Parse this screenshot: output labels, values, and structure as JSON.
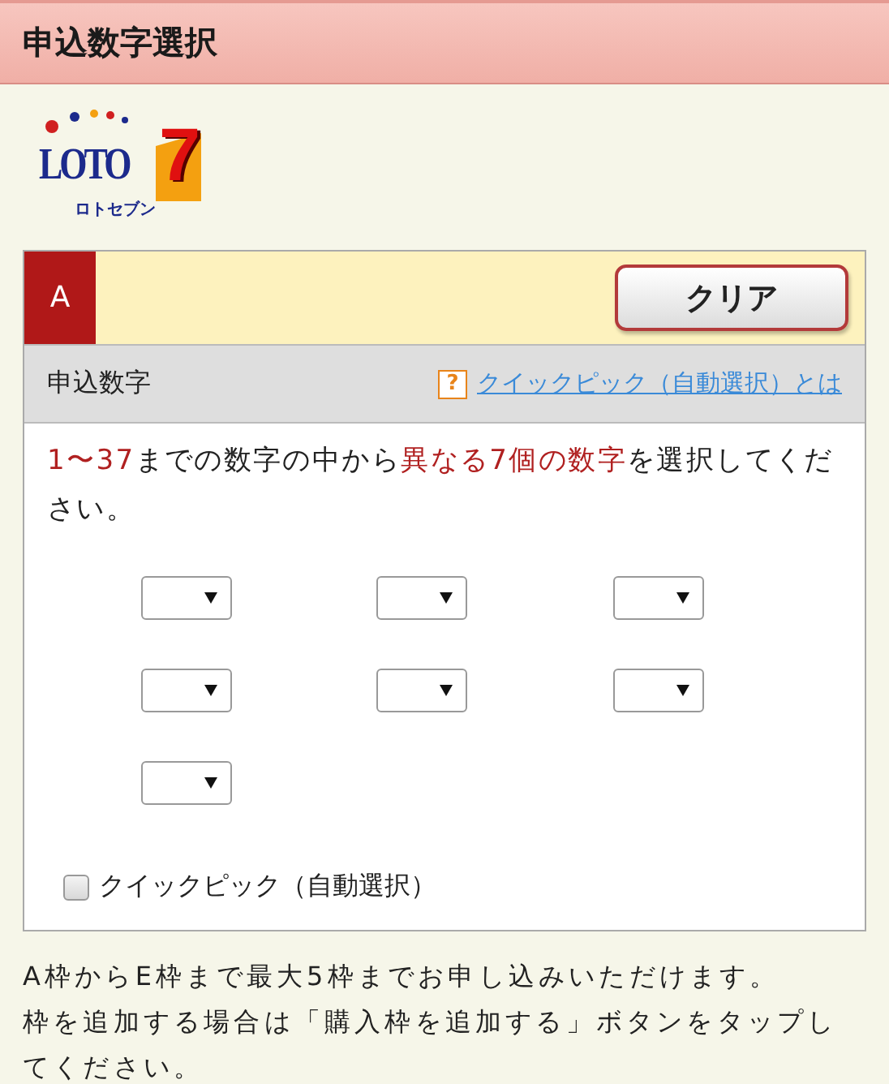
{
  "header": {
    "title": "申込数字選択"
  },
  "logo": {
    "word": "LOTO",
    "numeral": "7",
    "reading": "ロトセブン"
  },
  "panel": {
    "letter": "A",
    "clear_button": "クリア",
    "section_label": "申込数字",
    "help_badge": "?",
    "help_link": "クイックピック（自動選択）とは",
    "instruction": [
      {
        "text": "1〜37",
        "highlight": true
      },
      {
        "text": "までの数字の中から",
        "highlight": false
      },
      {
        "text": "異なる7個の数字",
        "highlight": true
      },
      {
        "text": "を選択してください。",
        "highlight": false
      }
    ],
    "selects": [
      {
        "kind": "dropdown"
      },
      {
        "kind": "dropdown"
      },
      {
        "kind": "dropdown"
      },
      {
        "kind": "dropdown"
      },
      {
        "kind": "dropdown"
      },
      {
        "kind": "dropdown"
      },
      {
        "kind": "dropdown"
      }
    ],
    "quick_pick": {
      "label": "クイックピック（自動選択）",
      "checked": false
    }
  },
  "notes": [
    "A枠からE枠まで最大5枠までお申し込みいただけます。",
    "枠を追加する場合は「購入枠を追加する」ボタンをタップしてください。"
  ]
}
